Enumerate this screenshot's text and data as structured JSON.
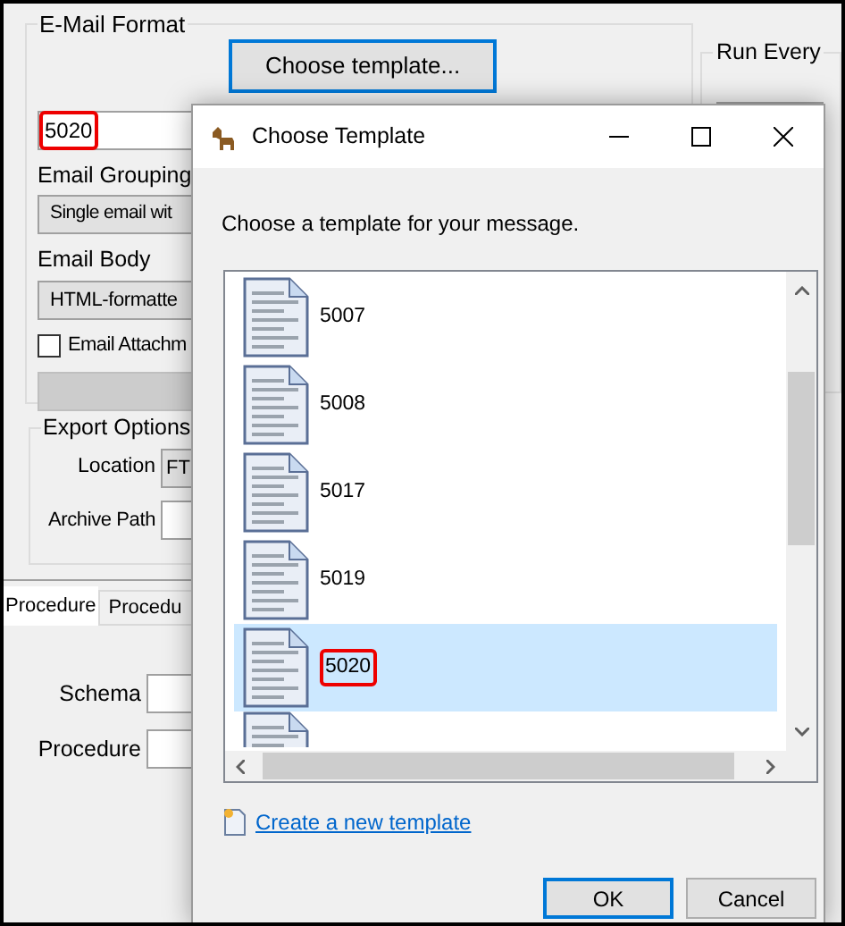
{
  "email_format": {
    "title": "E-Mail Format",
    "choose_button": "Choose template...",
    "template_field": {
      "value": "5020",
      "highlighted": true
    },
    "grouping_label": "Email Grouping",
    "grouping_value": "Single email wit",
    "body_label": "Email Body",
    "body_value": "HTML-formatte",
    "attachment": {
      "label": "Email Attachm",
      "checked": false
    }
  },
  "export_options": {
    "title": "Export Options",
    "location_label": "Location",
    "location_value": "FT",
    "archive_label": "Archive Path"
  },
  "tabs": [
    {
      "label": "Procedure",
      "selected": true
    },
    {
      "label": "Procedu",
      "selected": false
    }
  ],
  "procedure_fields": [
    {
      "label": "Schema"
    },
    {
      "label": "Procedure"
    }
  ],
  "schedule": {
    "title": "Run Every"
  },
  "dialog": {
    "title": "Choose Template",
    "prompt": "Choose a template for your message.",
    "templates": [
      {
        "name": "5007",
        "selected": false,
        "highlighted": false
      },
      {
        "name": "5008",
        "selected": false,
        "highlighted": false
      },
      {
        "name": "5017",
        "selected": false,
        "highlighted": false
      },
      {
        "name": "5019",
        "selected": false,
        "highlighted": false
      },
      {
        "name": "5020",
        "selected": true,
        "highlighted": true
      }
    ],
    "create_link": "Create a new template",
    "buttons": [
      {
        "label": "OK",
        "default": true
      },
      {
        "label": "Cancel",
        "default": false
      }
    ]
  }
}
